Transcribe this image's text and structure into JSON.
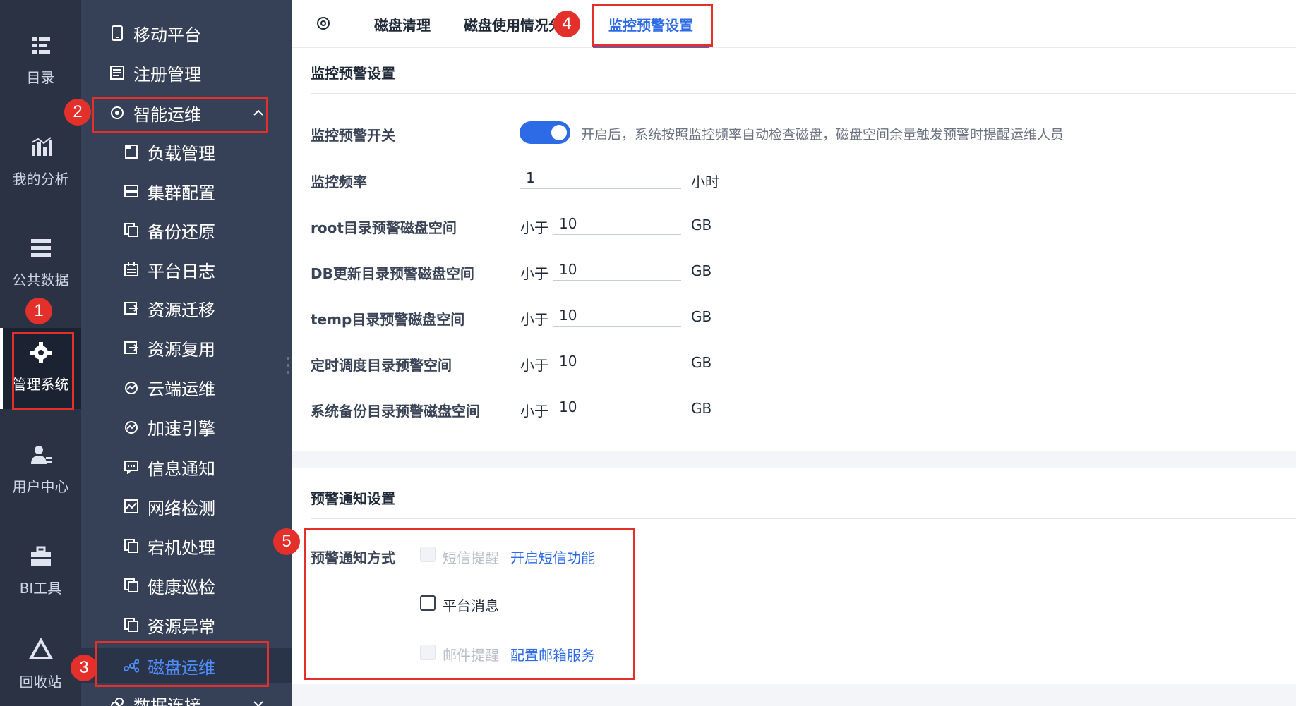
{
  "rail": {
    "items": [
      {
        "label": "目录",
        "icon": "catalog-icon"
      },
      {
        "label": "我的分析",
        "icon": "analysis-icon"
      },
      {
        "label": "公共数据",
        "icon": "public-data-icon"
      },
      {
        "label": "管理系统",
        "icon": "gear-icon",
        "active": true
      },
      {
        "label": "用户中心",
        "icon": "user-center-icon"
      },
      {
        "label": "BI工具",
        "icon": "toolbox-icon"
      },
      {
        "label": "回收站",
        "icon": "recycle-icon"
      }
    ]
  },
  "sidebar": {
    "top_item": "移动平台",
    "items": [
      {
        "label": "移动平台",
        "icon": "mobile-icon"
      },
      {
        "label": "注册管理",
        "icon": "register-icon"
      },
      {
        "label": "智能运维",
        "icon": "smart-ops-icon",
        "expanded": true
      },
      {
        "label": "负载管理",
        "icon": "load-icon"
      },
      {
        "label": "集群配置",
        "icon": "cluster-icon"
      },
      {
        "label": "备份还原",
        "icon": "backup-icon"
      },
      {
        "label": "平台日志",
        "icon": "log-icon"
      },
      {
        "label": "资源迁移",
        "icon": "migrate-icon"
      },
      {
        "label": "资源复用",
        "icon": "reuse-icon"
      },
      {
        "label": "云端运维",
        "icon": "cloud-ops-icon"
      },
      {
        "label": "加速引擎",
        "icon": "engine-icon"
      },
      {
        "label": "信息通知",
        "icon": "notice-icon"
      },
      {
        "label": "网络检测",
        "icon": "network-icon"
      },
      {
        "label": "宕机处理",
        "icon": "downtime-icon"
      },
      {
        "label": "健康巡检",
        "icon": "health-icon"
      },
      {
        "label": "资源异常",
        "icon": "resource-error-icon"
      },
      {
        "label": "磁盘运维",
        "icon": "disk-ops-icon",
        "active": true
      },
      {
        "label": "数据连接",
        "icon": "data-link-icon"
      }
    ]
  },
  "tabs": {
    "items": [
      "磁盘清理",
      "磁盘使用情况分",
      "监控预警设置"
    ],
    "active_index": 2
  },
  "monitor": {
    "title": "监控预警设置",
    "switch_label": "监控预警开关",
    "switch_on": true,
    "switch_hint": "开启后，系统按照监控频率自动检查磁盘，磁盘空间余量触发预警时提醒运维人员",
    "frequency_label": "监控频率",
    "frequency_value": "1",
    "frequency_unit": "小时",
    "rows": [
      {
        "label": "root目录预警磁盘空间",
        "prefix": "小于",
        "value": "10",
        "unit": "GB"
      },
      {
        "label": "DB更新目录预警磁盘空间",
        "prefix": "小于",
        "value": "10",
        "unit": "GB"
      },
      {
        "label": "temp目录预警磁盘空间",
        "prefix": "小于",
        "value": "10",
        "unit": "GB"
      },
      {
        "label": "定时调度目录预警空间",
        "prefix": "小于",
        "value": "10",
        "unit": "GB"
      },
      {
        "label": "系统备份目录预警磁盘空间",
        "prefix": "小于",
        "value": "10",
        "unit": "GB"
      }
    ]
  },
  "notify": {
    "title": "预警通知设置",
    "method_label": "预警通知方式",
    "sms_label": "短信提醒",
    "sms_link": "开启短信功能",
    "platform_label": "平台消息",
    "email_label": "邮件提醒",
    "email_link": "配置邮箱服务"
  },
  "annotations": [
    "1",
    "2",
    "3",
    "4",
    "5"
  ],
  "colors": {
    "accent": "#2d6ae6",
    "annotation": "#e4302b",
    "rail_bg": "#2a3244",
    "sidebar_bg": "#364057"
  }
}
